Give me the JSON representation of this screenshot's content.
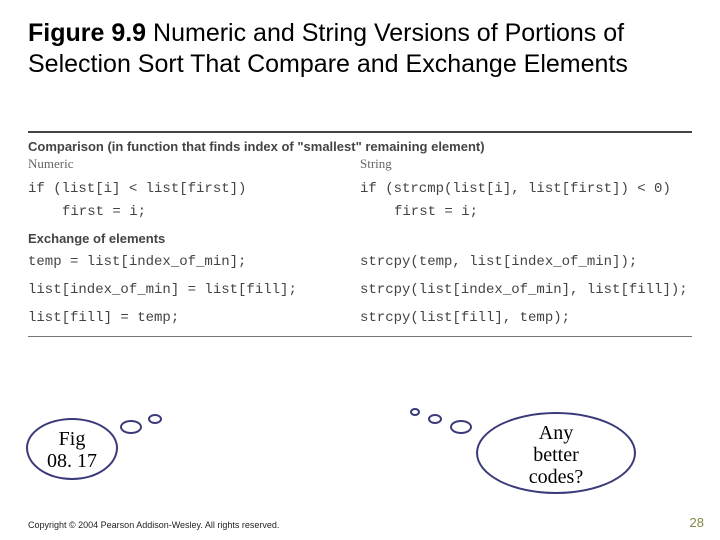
{
  "title": {
    "fignum": "Figure 9.9",
    "rest": "  Numeric and String Versions of Portions of Selection Sort That Compare and Exchange Elements"
  },
  "section1": {
    "heading": "Comparison (in function that finds index of \"smallest\" remaining element)",
    "numeric_label": "Numeric",
    "string_label": "String",
    "numeric_code_if": "if (list[i] < list[first])",
    "numeric_code_body": "first = i;",
    "string_code_if": "if (strcmp(list[i], list[first]) < 0)",
    "string_code_body": "first = i;"
  },
  "section2": {
    "heading": "Exchange of elements",
    "numeric_lines": [
      "temp = list[index_of_min];",
      "list[index_of_min] = list[fill];",
      "list[fill] = temp;"
    ],
    "string_lines": [
      "strcpy(temp, list[index_of_min]);",
      "strcpy(list[index_of_min], list[fill]);",
      "strcpy(list[fill], temp);"
    ]
  },
  "bubble_left_line1": "Fig",
  "bubble_left_line2": "08. 17",
  "bubble_right_line1": "Any",
  "bubble_right_line2": "better",
  "bubble_right_line3": "codes?",
  "copyright": "Copyright © 2004 Pearson Addison-Wesley. All rights reserved.",
  "page_number": "28"
}
